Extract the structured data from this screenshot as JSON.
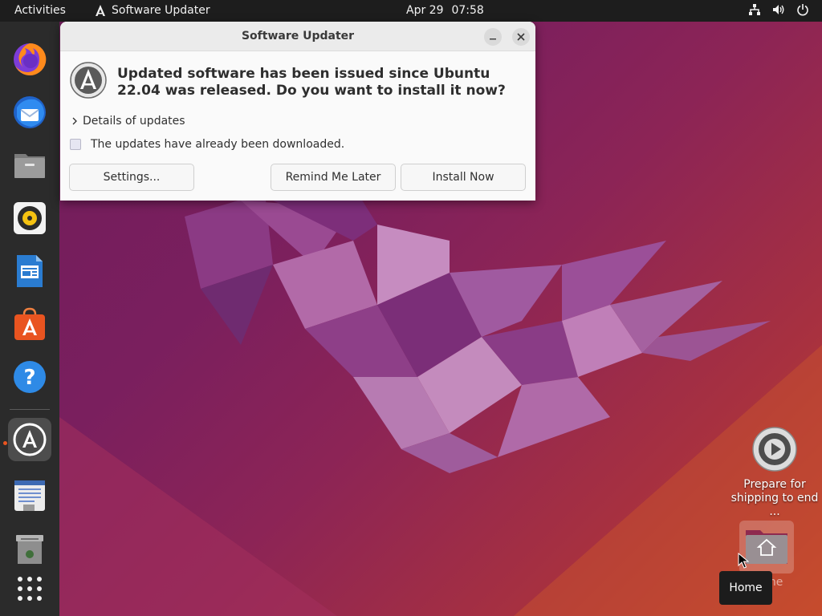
{
  "topbar": {
    "activities": "Activities",
    "app_name": "Software Updater",
    "date": "Apr 29",
    "time": "07:58",
    "status_icons": [
      "network-icon",
      "volume-icon",
      "power-icon"
    ]
  },
  "dock": {
    "items": [
      {
        "name": "firefox",
        "icon": "firefox-icon"
      },
      {
        "name": "thunderbird",
        "icon": "thunderbird-icon"
      },
      {
        "name": "files",
        "icon": "files-icon"
      },
      {
        "name": "rhythmbox",
        "icon": "rhythmbox-icon"
      },
      {
        "name": "libreoffice-writer",
        "icon": "writer-icon"
      },
      {
        "name": "ubuntu-software",
        "icon": "software-icon"
      },
      {
        "name": "help",
        "icon": "help-icon"
      },
      {
        "name": "software-updater",
        "icon": "updater-icon",
        "running": true
      },
      {
        "name": "text-editor",
        "icon": "text-editor-icon"
      },
      {
        "name": "trash",
        "icon": "trash-icon"
      },
      {
        "name": "show-apps",
        "icon": "app-grid-icon"
      }
    ]
  },
  "dialog": {
    "title": "Software Updater",
    "headline": "Updated software has been issued since Ubuntu 22.04 was released. Do you want to install it now?",
    "details": "Details of updates",
    "note": "The updates have already been downloaded.",
    "buttons": {
      "settings": "Settings...",
      "remind": "Remind Me Later",
      "install": "Install Now"
    }
  },
  "desktop": {
    "prepare_label": "Prepare for shipping to end ...",
    "home_label": "Home",
    "tooltip": "Home"
  },
  "colors": {
    "topbar": "#1d1d1d",
    "dock": "#2b2b2b",
    "accent": "#e95420",
    "dialog_bg": "#fafafa"
  }
}
